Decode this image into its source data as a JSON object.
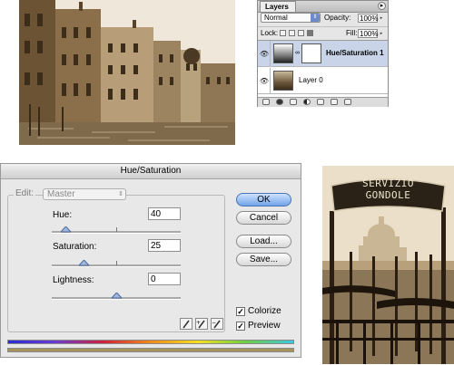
{
  "layers_panel": {
    "tab": "Layers",
    "blend_mode": "Normal",
    "opacity_label": "Opacity:",
    "opacity_value": "100%",
    "lock_label": "Lock:",
    "fill_label": "Fill:",
    "fill_value": "100%",
    "layers": [
      {
        "name": "Hue/Saturation 1",
        "selected": true
      },
      {
        "name": "Layer 0",
        "selected": false
      }
    ]
  },
  "hue_saturation": {
    "title": "Hue/Saturation",
    "edit_label": "Edit:",
    "edit_value": "Master",
    "hue_label": "Hue:",
    "hue_value": "40",
    "hue_level": 0.111,
    "saturation_label": "Saturation:",
    "saturation_value": "25",
    "saturation_level": 0.25,
    "lightness_label": "Lightness:",
    "lightness_value": "0",
    "lightness_level": 0.5,
    "buttons": {
      "ok": "OK",
      "cancel": "Cancel",
      "load": "Load...",
      "save": "Save..."
    },
    "colorize_label": "Colorize",
    "colorize_checked": true,
    "preview_label": "Preview",
    "preview_checked": true,
    "top_bar_colors": [
      "#2b2bd8",
      "#6a3bd0",
      "#d0203a",
      "#f08a18",
      "#f5e020",
      "#6ad040",
      "#3ac8e0"
    ],
    "bottom_bar_color": "#a8925c"
  },
  "photo_gondole": {
    "sign_line1": "SERVIZIO",
    "sign_line2": "GONDOLE"
  }
}
